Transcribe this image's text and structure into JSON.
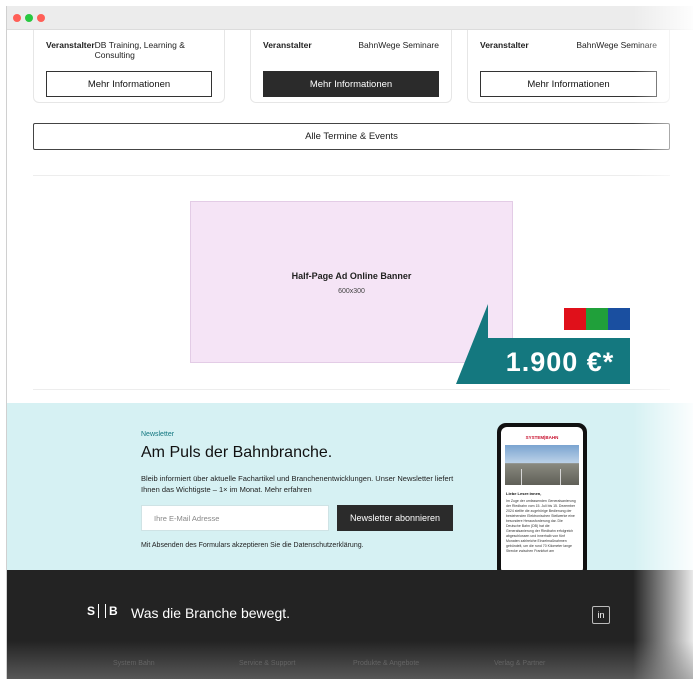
{
  "window": {
    "dots": [
      "#ff5f57",
      "#28c840",
      "#ff5f57"
    ]
  },
  "events": [
    {
      "label": "Veranstalter",
      "value": "DB Training, Learning & Consulting",
      "button": "Mehr Informationen",
      "style": "light"
    },
    {
      "label": "Veranstalter",
      "value": "BahnWege Seminare",
      "button": "Mehr Informationen",
      "style": "dark"
    },
    {
      "label": "Veranstalter",
      "value": "BahnWege Seminare",
      "button": "Mehr Informationen",
      "style": "light"
    }
  ],
  "all_events_label": "Alle Termine & Events",
  "ad": {
    "title": "Half-Page Ad Online Banner",
    "size": "600x300"
  },
  "price": {
    "value": "1.900 €*",
    "swatches": [
      "#e0101a",
      "#20a03a",
      "#1a4fa0"
    ]
  },
  "newsletter": {
    "kicker": "Newsletter",
    "title": "Am Puls der Bahnbranche.",
    "text": "Bleib informiert über aktuelle Fachartikel und Branchenentwicklungen. Unser Newsletter liefert Ihnen das Wichtigste – 1× im Monat. Mehr erfahren",
    "email_placeholder": "Ihre E-Mail Adresse",
    "button": "Newsletter abonnieren",
    "note": "Mit Absenden des Formulars akzeptieren Sie die Datenschutzerklärung.",
    "phone": {
      "logo": "SYSTEM|BAHN",
      "greeting": "Liebe Leser:innen,",
      "body": "Im Zuge der umfassenden Generalsanierung der Riedbahn vom 15. Juli bis 15. Dezember 2024 stellte die zugehörige Bedienung der bestehenden Elektronischen Stellwerke eine besondere Herausforderung dar. Die Deutsche Bahn (DB) hat die Generalsanierung der Riedbahn erfolgreich abgeschlossen und innerhalb von fünf Monaten zahlreiche Einzelmaßnahmen gebündelt, um die rund 70 Kilometer lange Strecke zwischen Frankfurt am"
    }
  },
  "footer": {
    "logo_left": "S",
    "logo_right": "B",
    "claim": "Was die Branche bewegt.",
    "social": "in",
    "links": [
      "System Bahn",
      "Service & Support",
      "Produkte & Angebote",
      "Verlag & Partner"
    ]
  }
}
